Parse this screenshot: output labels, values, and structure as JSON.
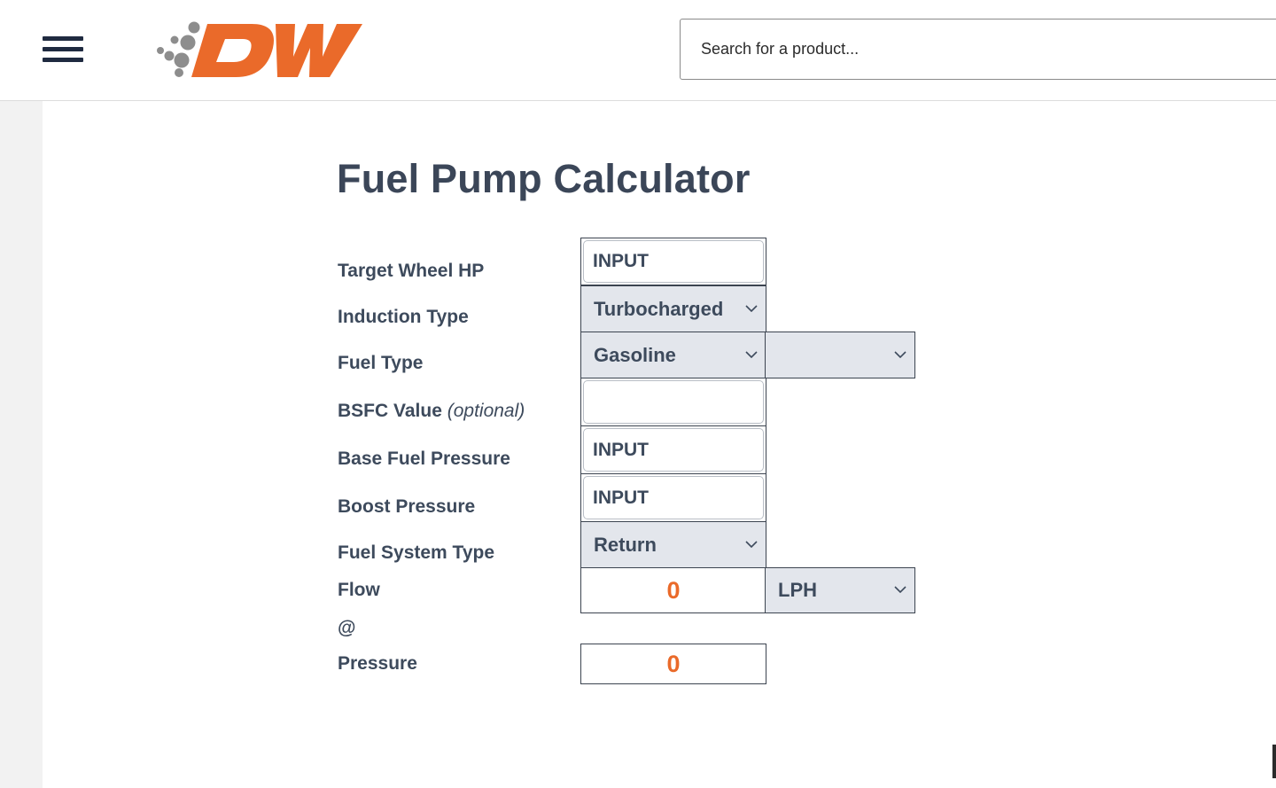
{
  "header": {
    "logo_text": "DW",
    "search_placeholder": "Search for a product..."
  },
  "page": {
    "title": "Fuel Pump Calculator"
  },
  "form": {
    "target_wheel_hp": {
      "label": "Target Wheel HP",
      "value": "INPUT"
    },
    "induction_type": {
      "label": "Induction Type",
      "selected": "Turbocharged"
    },
    "fuel_type": {
      "label": "Fuel Type",
      "selected": "Gasoline",
      "secondary_selected": ""
    },
    "bsfc_value": {
      "label": "BSFC Value",
      "label_note": "(optional)",
      "value": ""
    },
    "base_fuel_pressure": {
      "label": "Base Fuel Pressure",
      "value": "INPUT"
    },
    "boost_pressure": {
      "label": "Boost Pressure",
      "value": "INPUT"
    },
    "fuel_system_type": {
      "label": "Fuel System Type",
      "selected": "Return"
    },
    "flow": {
      "label": "Flow",
      "value": "0",
      "unit": "LPH"
    },
    "at_symbol": "@",
    "pressure": {
      "label": "Pressure",
      "value": "0"
    }
  },
  "colors": {
    "brand_orange": "#ea6a2a",
    "text_slate": "#3d4a5c",
    "select_bg": "#e3e6ec",
    "nav_dark": "#1f2a40"
  }
}
